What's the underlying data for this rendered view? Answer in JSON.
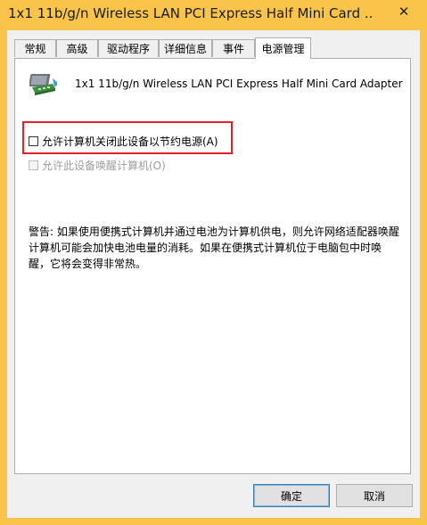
{
  "window": {
    "title": "1x1 11b/g/n Wireless LAN PCI Express Half Mini Card ...",
    "close_symbol": "✕"
  },
  "tabs": [
    {
      "label": "常规"
    },
    {
      "label": "高级"
    },
    {
      "label": "驱动程序"
    },
    {
      "label": "详细信息"
    },
    {
      "label": "事件"
    },
    {
      "label": "电源管理",
      "active": true
    }
  ],
  "device": {
    "icon": "network-adapter-icon",
    "name": "1x1 11b/g/n Wireless LAN PCI Express Half Mini Card Adapter"
  },
  "options": {
    "allow_power_off": {
      "label": "允许计算机关闭此设备以节约电源(A)",
      "checked": false
    },
    "allow_wake": {
      "label": "允许此设备唤醒计算机(O)",
      "checked": false,
      "disabled": true
    }
  },
  "warning": {
    "line1": "警告: 如果使用便携式计算机并通过电池为计算机供电，则允许网络适配器唤醒",
    "line2": "计算机可能会加快电池电量的消耗。如果在便携式计算机位于电脑包中时唤",
    "line3": "醒，它将会变得非常热。"
  },
  "buttons": {
    "ok": "确定",
    "cancel": "取消"
  },
  "colors": {
    "frame": "#f9c449",
    "highlight_border": "#e3212b"
  }
}
